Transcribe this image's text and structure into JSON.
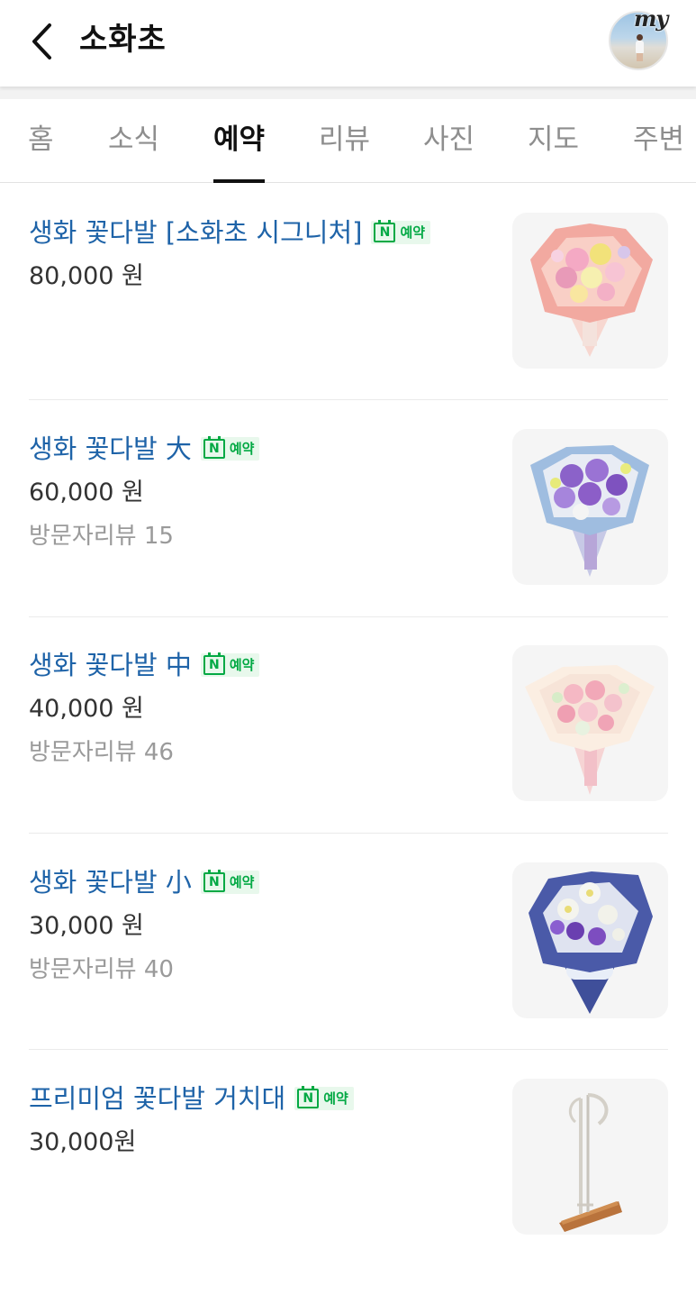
{
  "header": {
    "title": "소화초",
    "back_icon": "chevron-left-icon",
    "avatar_badge": "my"
  },
  "tabs": [
    {
      "label": "홈",
      "active": false
    },
    {
      "label": "소식",
      "active": false
    },
    {
      "label": "예약",
      "active": true
    },
    {
      "label": "리뷰",
      "active": false
    },
    {
      "label": "사진",
      "active": false
    },
    {
      "label": "지도",
      "active": false
    },
    {
      "label": "주변",
      "active": false
    }
  ],
  "menu": [
    {
      "name": "생화 꽃다발 [소화초 시그니처]",
      "badge": "예약",
      "price": "80,000 원",
      "review": "",
      "image": "pink-bouquet"
    },
    {
      "name": "생화 꽃다발 大",
      "badge": "예약",
      "price": "60,000 원",
      "review": "방문자리뷰 15",
      "image": "purple-bouquet"
    },
    {
      "name": "생화 꽃다발 中",
      "badge": "예약",
      "price": "40,000 원",
      "review": "방문자리뷰 46",
      "image": "light-pink-bouquet"
    },
    {
      "name": "생화 꽃다발 小",
      "badge": "예약",
      "price": "30,000 원",
      "review": "방문자리뷰 40",
      "image": "navy-bouquet"
    },
    {
      "name": "프리미엄 꽃다발 거치대",
      "badge": "예약",
      "price": "30,000원",
      "review": "",
      "image": "bouquet-stand"
    }
  ],
  "colors": {
    "item_name": "#1e63a8",
    "npay_green": "#03a944",
    "npay_bg": "#e8f8ec",
    "active_tab": "#111111",
    "inactive_tab": "#8e8e8e"
  }
}
